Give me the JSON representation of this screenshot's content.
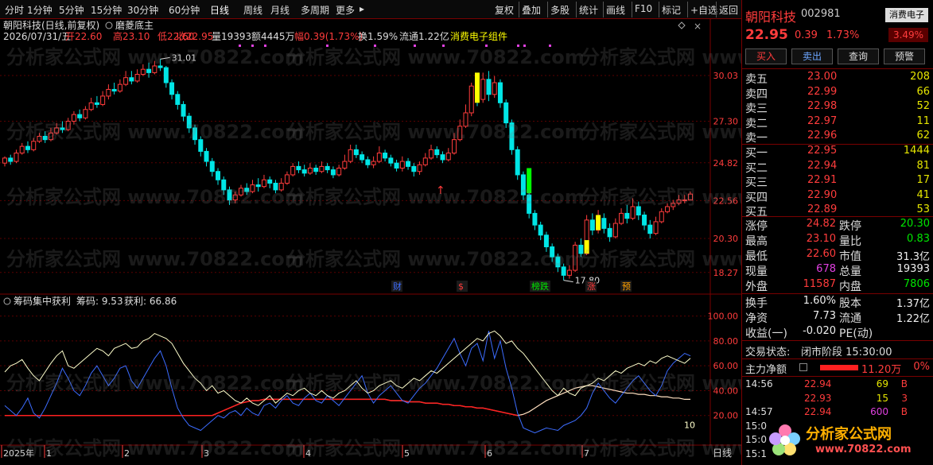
{
  "toolbar": {
    "periods": [
      "分时",
      "1分钟",
      "5分钟",
      "15分钟",
      "30分钟",
      "60分钟",
      "日线",
      "周线",
      "月线",
      "多周期",
      "更多"
    ],
    "active_period": "日线",
    "right_buttons": [
      "复权",
      "叠加",
      "多股",
      "统计",
      "画线",
      "F10",
      "标记",
      "+自选",
      "返回"
    ]
  },
  "main_chart": {
    "title_line": "朝阳科技(日线,前复权)",
    "indicator_name": "磨菱底主",
    "info_date": "2026/07/31/五",
    "info_open": "开22.60",
    "info_high": "高23.10",
    "info_low": "低22.60",
    "info_close": "收22.95",
    "info_vol": "量19393",
    "info_amount": "额4445万",
    "info_change": "幅0.39(1.73%)",
    "info_turnover": "换1.59%",
    "info_float": "流通1.22亿",
    "info_sector": "消费电子组件",
    "price_axis": [
      "30.03",
      "27.30",
      "24.82",
      "22.56",
      "20.30",
      "18.27"
    ],
    "high_marker": "31.01",
    "low_marker": "17.80",
    "event_tags": [
      "财",
      "$",
      "榜跌",
      "涨",
      "预"
    ]
  },
  "sub_chart": {
    "title": "筹码集中获利",
    "chip_label": "筹码: 9.53",
    "profit_label": "获利: 66.86",
    "axis": [
      "100.00",
      "80.00",
      "60.00",
      "40.00",
      "20.00"
    ],
    "end_label": "10"
  },
  "x_axis": {
    "labels": [
      "2025年",
      "1",
      "2",
      "3",
      "4",
      "5",
      "6",
      "7"
    ],
    "period_label": "日线"
  },
  "watermark": "分析家公式网 www.70822.com",
  "right_panel": {
    "stock_name": "朝阳科技",
    "stock_code": "002981",
    "sector_badge": "消费电子",
    "sector_pct": "3.49%",
    "price": "22.95",
    "change": "0.39",
    "change_pct": "1.73%",
    "buttons": [
      "买入",
      "卖出",
      "查询",
      "预警"
    ],
    "asks": [
      {
        "label": "卖五",
        "price": "23.00",
        "vol": "208"
      },
      {
        "label": "卖四",
        "price": "22.99",
        "vol": "66"
      },
      {
        "label": "卖三",
        "price": "22.98",
        "vol": "52"
      },
      {
        "label": "卖二",
        "price": "22.97",
        "vol": "11"
      },
      {
        "label": "卖一",
        "price": "22.96",
        "vol": "62"
      }
    ],
    "bids": [
      {
        "label": "买一",
        "price": "22.95",
        "vol": "1444"
      },
      {
        "label": "买二",
        "price": "22.94",
        "vol": "81"
      },
      {
        "label": "买三",
        "price": "22.91",
        "vol": "17"
      },
      {
        "label": "买四",
        "price": "22.90",
        "vol": "41"
      },
      {
        "label": "买五",
        "price": "22.89",
        "vol": "53"
      }
    ],
    "stats": [
      {
        "l1": "涨停",
        "v1": "24.82",
        "c1": "red",
        "l2": "跌停",
        "v2": "20.30",
        "c2": "green"
      },
      {
        "l1": "最高",
        "v1": "23.10",
        "c1": "red",
        "l2": "量比",
        "v2": "0.83",
        "c2": "green"
      },
      {
        "l1": "最低",
        "v1": "22.60",
        "c1": "red",
        "l2": "市值",
        "v2": "31.3亿",
        "c2": "white"
      },
      {
        "l1": "现量",
        "v1": "678",
        "c1": "purple",
        "l2": "总量",
        "v2": "19393",
        "c2": "white"
      },
      {
        "l1": "外盘",
        "v1": "11587",
        "c1": "red",
        "l2": "内盘",
        "v2": "7806",
        "c2": "green"
      }
    ],
    "stats2": [
      {
        "l1": "换手",
        "v1": "1.60%",
        "l2": "股本",
        "v2": "1.37亿"
      },
      {
        "l1": "净资",
        "v1": "7.73",
        "l2": "流通",
        "v2": "1.22亿"
      },
      {
        "l1": "收益(一)",
        "v1": "-0.020",
        "l2": "PE(动)",
        "v2": ""
      }
    ],
    "trade_status_label": "交易状态:",
    "trade_status": "闭市阶段 15:30:00",
    "main_flow_label": "主力净额",
    "main_flow_value": "11.20万",
    "main_flow_pct": "0%",
    "ticks": [
      {
        "time": "14:56",
        "price": "22.94",
        "vol": "69",
        "side": "B"
      },
      {
        "time": "",
        "price": "22.93",
        "vol": "15",
        "side": "3"
      },
      {
        "time": "14:57",
        "price": "22.94",
        "vol": "600",
        "side": "B"
      },
      {
        "time": "15:0",
        "price": "",
        "vol": "",
        "side": ""
      },
      {
        "time": "15:0",
        "price": "",
        "vol": "",
        "side": ""
      },
      {
        "time": "15:1",
        "price": "",
        "vol": "",
        "side": ""
      }
    ],
    "logo_text": "分析家公式网",
    "logo_url": "www.70822.com"
  },
  "colors": {
    "up": "#ff3c3c",
    "down": "#00e6e6",
    "yellow": "#ffff00",
    "green_bar": "#00ff00",
    "border": "#7a0000",
    "chip_line": "#ffffcc",
    "profit_line": "#3c6cff",
    "red_line": "#ff2020"
  },
  "chart_data": {
    "type": "candlestick",
    "ylim": [
      17.5,
      31.5
    ],
    "candles": [
      [
        24.8,
        25.1,
        25.2,
        24.6
      ],
      [
        25.1,
        24.9,
        25.3,
        24.7
      ],
      [
        24.9,
        25.4,
        25.6,
        24.8
      ],
      [
        25.4,
        25.8,
        26,
        25.3
      ],
      [
        25.8,
        25.6,
        26.1,
        25.4
      ],
      [
        25.6,
        26.1,
        26.3,
        25.5
      ],
      [
        26.1,
        26.4,
        26.6,
        26
      ],
      [
        26.4,
        26.2,
        26.7,
        26
      ],
      [
        26.2,
        26.6,
        26.9,
        26.1
      ],
      [
        26.6,
        26.9,
        27.2,
        26.5
      ],
      [
        26.9,
        26.8,
        27.3,
        26.6
      ],
      [
        26.8,
        27.3,
        27.5,
        26.7
      ],
      [
        27.3,
        27.7,
        27.9,
        27.1
      ],
      [
        27.7,
        27.5,
        28,
        27.3
      ],
      [
        27.5,
        28,
        28.2,
        27.4
      ],
      [
        28,
        28.4,
        28.7,
        27.9
      ],
      [
        28.4,
        28.3,
        28.8,
        28.1
      ],
      [
        28.3,
        28.8,
        29.1,
        28.2
      ],
      [
        28.8,
        29.2,
        29.5,
        28.6
      ],
      [
        29.2,
        29.1,
        29.6,
        28.9
      ],
      [
        29.1,
        29.5,
        29.8,
        29
      ],
      [
        29.5,
        29.9,
        30.3,
        29.4
      ],
      [
        29.9,
        29.7,
        30.3,
        29.5
      ],
      [
        29.7,
        30.1,
        30.4,
        29.6
      ],
      [
        30.1,
        30.4,
        30.7,
        30
      ],
      [
        30.4,
        30.2,
        30.8,
        29.9
      ],
      [
        30.2,
        30.6,
        30.9,
        30.1
      ],
      [
        30.6,
        30.5,
        31.01,
        30.3
      ],
      [
        30.5,
        29.6,
        30.6,
        29.3
      ],
      [
        29.6,
        28.9,
        29.8,
        28.6
      ],
      [
        28.9,
        28.3,
        29.1,
        28
      ],
      [
        28.3,
        27.6,
        28.5,
        27.3
      ],
      [
        27.6,
        26.9,
        27.8,
        26.6
      ],
      [
        26.9,
        26.2,
        27.1,
        25.9
      ],
      [
        26.2,
        25.5,
        26.4,
        25.2
      ],
      [
        25.5,
        24.9,
        25.7,
        24.6
      ],
      [
        24.9,
        24.3,
        25.1,
        24
      ],
      [
        24.3,
        23.8,
        24.5,
        23.5
      ],
      [
        23.8,
        23.2,
        24,
        22.9
      ],
      [
        23.2,
        22.6,
        23.4,
        22.3
      ],
      [
        22.6,
        22.9,
        23.1,
        22.4
      ],
      [
        22.9,
        23.3,
        23.5,
        22.8
      ],
      [
        23.3,
        23.1,
        23.6,
        22.9
      ],
      [
        23.1,
        23.5,
        23.8,
        23
      ],
      [
        23.5,
        23.4,
        23.9,
        23.1
      ],
      [
        23.4,
        23.8,
        24.1,
        23.3
      ],
      [
        23.8,
        23.6,
        24,
        23.3
      ],
      [
        23.6,
        23.2,
        23.8,
        23
      ],
      [
        23.2,
        23.6,
        23.9,
        23.1
      ],
      [
        23.6,
        24.1,
        24.3,
        23.5
      ],
      [
        24.1,
        24.6,
        24.8,
        24
      ],
      [
        24.6,
        24.4,
        24.9,
        24.2
      ],
      [
        24.4,
        24.2,
        24.7,
        24
      ],
      [
        24.2,
        24.5,
        24.8,
        24.1
      ],
      [
        24.5,
        24.3,
        24.7,
        24.1
      ],
      [
        24.3,
        24.6,
        24.9,
        24.2
      ],
      [
        24.6,
        24.4,
        24.8,
        24.2
      ],
      [
        24.4,
        24.1,
        24.6,
        23.9
      ],
      [
        24.1,
        24.5,
        24.7,
        24
      ],
      [
        24.5,
        24.9,
        25.3,
        24.4
      ],
      [
        24.9,
        25.6,
        25.9,
        24.8
      ],
      [
        25.6,
        25.3,
        25.9,
        25.1
      ],
      [
        25.3,
        25,
        25.5,
        24.8
      ],
      [
        25,
        24.7,
        25.2,
        24.5
      ],
      [
        24.7,
        24.9,
        25.2,
        24.5
      ],
      [
        24.9,
        25.4,
        25.8,
        24.8
      ],
      [
        25.4,
        25.1,
        25.6,
        24.9
      ],
      [
        25.1,
        24.8,
        25.3,
        24.6
      ],
      [
        24.8,
        24.5,
        25,
        24.3
      ],
      [
        24.5,
        24.9,
        25.2,
        24.3
      ],
      [
        24.9,
        24.6,
        25.1,
        24.4
      ],
      [
        24.6,
        24.3,
        24.8,
        24
      ],
      [
        24.3,
        24.7,
        24.9,
        24.1
      ],
      [
        24.7,
        25.1,
        25.4,
        24.6
      ],
      [
        25.1,
        25.6,
        25.9,
        25
      ],
      [
        25.6,
        25.3,
        25.8,
        25.1
      ],
      [
        25.3,
        25,
        25.5,
        24.8
      ],
      [
        25,
        25.4,
        25.7,
        24.9
      ],
      [
        25.4,
        26.2,
        26.6,
        25.3
      ],
      [
        26.2,
        27,
        27.4,
        26.1
      ],
      [
        27,
        27.8,
        28.3,
        26.9
      ],
      [
        27.8,
        29.4,
        29.6,
        27.6
      ],
      [
        29.4,
        28.6,
        29.8,
        28.2
      ],
      [
        28.6,
        29.8,
        30.2,
        28.4
      ],
      [
        29.8,
        28.9,
        30.3,
        28.5
      ],
      [
        28.9,
        29.6,
        30,
        28.7
      ],
      [
        29.6,
        28.4,
        29.8,
        28.1
      ],
      [
        28.4,
        27.2,
        28.6,
        26.9
      ],
      [
        27.2,
        25.6,
        27.4,
        25.3
      ],
      [
        25.6,
        24.1,
        25.8,
        23.8
      ],
      [
        24.1,
        22.9,
        24.3,
        22.6
      ],
      [
        22.9,
        21.8,
        23.1,
        21.5
      ],
      [
        21.8,
        21.1,
        22,
        20.8
      ],
      [
        21.1,
        20.5,
        21.3,
        20.2
      ],
      [
        20.5,
        19.8,
        20.7,
        19.5
      ],
      [
        19.8,
        19.2,
        20,
        18.9
      ],
      [
        19.2,
        18.6,
        19.4,
        18.3
      ],
      [
        18.6,
        18.1,
        18.8,
        17.8
      ],
      [
        18.1,
        18.4,
        18.7,
        17.9
      ],
      [
        18.4,
        19.9,
        20.1,
        18.3
      ],
      [
        19.9,
        19.4,
        20.3,
        19.2
      ],
      [
        19.4,
        21.4,
        21.7,
        19.3
      ],
      [
        21.4,
        20.8,
        21.8,
        20.5
      ],
      [
        20.8,
        21.5,
        22,
        20.6
      ],
      [
        21.5,
        20.9,
        21.8,
        20.6
      ],
      [
        20.9,
        20.4,
        21.2,
        20.1
      ],
      [
        20.4,
        21.2,
        21.5,
        20.3
      ],
      [
        21.2,
        21.8,
        22.1,
        21.1
      ],
      [
        21.8,
        21.5,
        22.3,
        21.2
      ],
      [
        21.5,
        22.2,
        22.7,
        21.4
      ],
      [
        22.2,
        21.7,
        22.5,
        21.4
      ],
      [
        21.7,
        21.1,
        21.9,
        20.8
      ],
      [
        21.1,
        20.6,
        21.4,
        20.3
      ],
      [
        20.6,
        21.3,
        21.6,
        20.5
      ],
      [
        21.3,
        21.9,
        22.1,
        21.2
      ],
      [
        21.9,
        22.2,
        22.4,
        21.8
      ],
      [
        22.2,
        22.4,
        22.6,
        22
      ],
      [
        22.4,
        22.6,
        22.9,
        22.3
      ],
      [
        22.6,
        22.6,
        22.9,
        22.4
      ],
      [
        22.6,
        22.95,
        23.1,
        22.6
      ]
    ],
    "chip_series": [
      55,
      60,
      62,
      65,
      58,
      52,
      48,
      55,
      62,
      68,
      72,
      60,
      58,
      62,
      66,
      70,
      74,
      72,
      68,
      74,
      76,
      78,
      74,
      75,
      80,
      82,
      86,
      84,
      82,
      78,
      70,
      62,
      56,
      50,
      46,
      40,
      44,
      38,
      40,
      36,
      32,
      30,
      34,
      30,
      28,
      32,
      36,
      30,
      34,
      38,
      36,
      40,
      42,
      38,
      36,
      40,
      36,
      34,
      38,
      40,
      44,
      48,
      42,
      38,
      40,
      44,
      46,
      48,
      44,
      42,
      46,
      50,
      48,
      52,
      56,
      54,
      58,
      62,
      66,
      70,
      74,
      78,
      82,
      80,
      86,
      88,
      84,
      78,
      80,
      74,
      70,
      64,
      58,
      52,
      46,
      40,
      36,
      42,
      38,
      36,
      42,
      44,
      46,
      50,
      48,
      52,
      56,
      54,
      58,
      60,
      62,
      60,
      64,
      62,
      66,
      68,
      66,
      64,
      62,
      66
    ],
    "profit_series": [
      28,
      24,
      20,
      26,
      34,
      22,
      18,
      26,
      36,
      46,
      58,
      50,
      40,
      36,
      44,
      54,
      60,
      52,
      44,
      50,
      58,
      60,
      48,
      42,
      50,
      58,
      66,
      72,
      60,
      42,
      26,
      18,
      12,
      10,
      8,
      12,
      16,
      20,
      18,
      22,
      24,
      20,
      26,
      22,
      20,
      28,
      30,
      26,
      32,
      36,
      30,
      28,
      34,
      38,
      32,
      30,
      36,
      32,
      28,
      34,
      40,
      46,
      52,
      38,
      30,
      36,
      40,
      44,
      38,
      32,
      30,
      36,
      42,
      46,
      52,
      58,
      66,
      74,
      82,
      70,
      60,
      74,
      78,
      64,
      88,
      66,
      80,
      58,
      42,
      22,
      10,
      8,
      6,
      8,
      10,
      9,
      8,
      12,
      14,
      16,
      20,
      26,
      38,
      46,
      40,
      34,
      30,
      36,
      42,
      48,
      52,
      46,
      40,
      36,
      44,
      56,
      62,
      66,
      70,
      68
    ],
    "red_series": [
      20,
      20,
      20,
      20,
      20,
      20,
      20,
      20,
      20,
      20,
      20,
      20,
      20,
      20,
      20,
      20,
      20,
      20,
      20,
      20,
      20,
      20,
      20,
      20,
      20,
      20,
      20,
      20,
      20,
      20,
      20,
      20,
      20,
      20,
      20,
      20,
      20,
      22,
      24,
      26,
      28,
      30,
      31,
      32,
      32,
      33,
      33,
      33,
      33,
      33,
      33,
      33,
      33,
      33,
      33,
      33,
      33,
      33,
      33,
      33,
      33,
      33,
      33,
      33,
      33,
      33,
      33,
      32,
      32,
      32,
      31,
      31,
      31,
      30,
      30,
      30,
      29,
      29,
      28,
      28,
      27,
      27,
      26,
      26,
      25,
      24,
      23,
      22,
      21,
      20,
      19,
      18,
      18,
      18,
      18,
      18,
      18,
      18,
      18,
      18,
      18,
      18,
      18,
      18,
      18,
      18,
      18,
      18,
      18,
      18,
      18,
      18,
      18,
      18,
      18,
      18,
      18,
      18,
      18,
      18
    ],
    "white_series": [
      20,
      20,
      20,
      20,
      20,
      20,
      20,
      20,
      20,
      20,
      20,
      20,
      20,
      20,
      20,
      20,
      20,
      20,
      20,
      20,
      20,
      20,
      20,
      20,
      20,
      20,
      20,
      20,
      20,
      20,
      20,
      20,
      20,
      20,
      20,
      20,
      20,
      22,
      24,
      26,
      28,
      30,
      31,
      32,
      32,
      33,
      33,
      33,
      33,
      33,
      33,
      33,
      33,
      33,
      33,
      33,
      33,
      33,
      33,
      33,
      33,
      33,
      33,
      33,
      33,
      33,
      33,
      32,
      32,
      32,
      31,
      31,
      31,
      30,
      30,
      30,
      29,
      29,
      28,
      28,
      27,
      27,
      26,
      26,
      25,
      24,
      23,
      22,
      21,
      20,
      21,
      23,
      26,
      29,
      32,
      34,
      36,
      38,
      40,
      42,
      43,
      44,
      44,
      43,
      42,
      41,
      40,
      39,
      38,
      38,
      37,
      37,
      36,
      36,
      35,
      35,
      34,
      34,
      33,
      33
    ]
  }
}
